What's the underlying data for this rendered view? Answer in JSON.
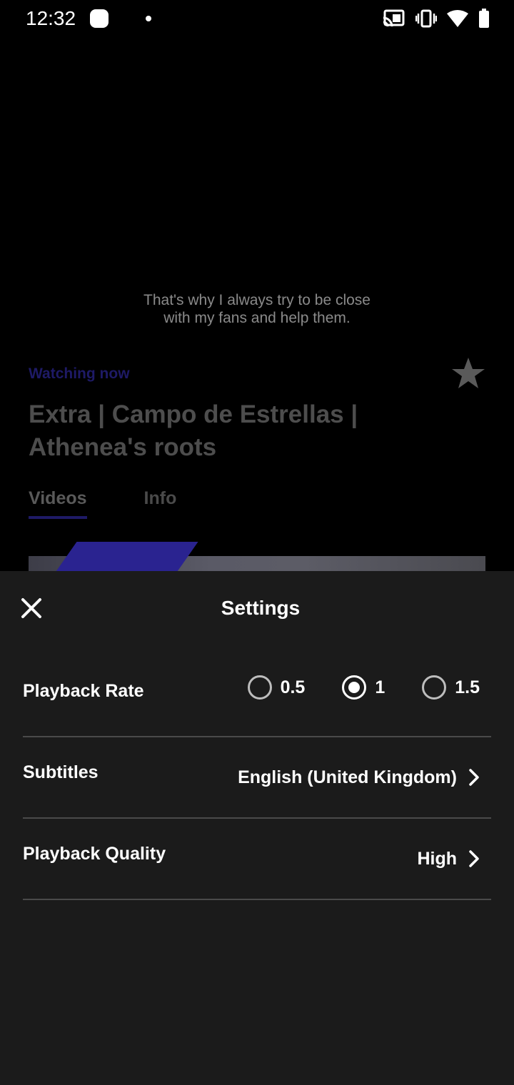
{
  "status_bar": {
    "time": "12:32",
    "icons": [
      "app-notification-icon",
      "dot-icon",
      "cast-icon",
      "vibrate-icon",
      "wifi-icon",
      "battery-icon"
    ]
  },
  "player": {
    "caption": "That's why I always try to be close\nwith my fans and help them."
  },
  "content": {
    "watching_label": "Watching now",
    "title": "Extra | Campo de Estrellas | Athenea's roots",
    "tabs": [
      {
        "label": "Videos",
        "active": true
      },
      {
        "label": "Info",
        "active": false
      }
    ]
  },
  "settings": {
    "title": "Settings",
    "playback_rate": {
      "label": "Playback Rate",
      "options": [
        {
          "label": "0.5",
          "selected": false
        },
        {
          "label": "1",
          "selected": true
        },
        {
          "label": "1.5",
          "selected": false
        }
      ]
    },
    "subtitles": {
      "label": "Subtitles",
      "value": "English (United Kingdom)"
    },
    "playback_quality": {
      "label": "Playback Quality",
      "value": "High"
    }
  },
  "colors": {
    "sheet_background": "#1b1b1b",
    "accent": "#1e1a66",
    "divider": "#4a4a4a"
  }
}
